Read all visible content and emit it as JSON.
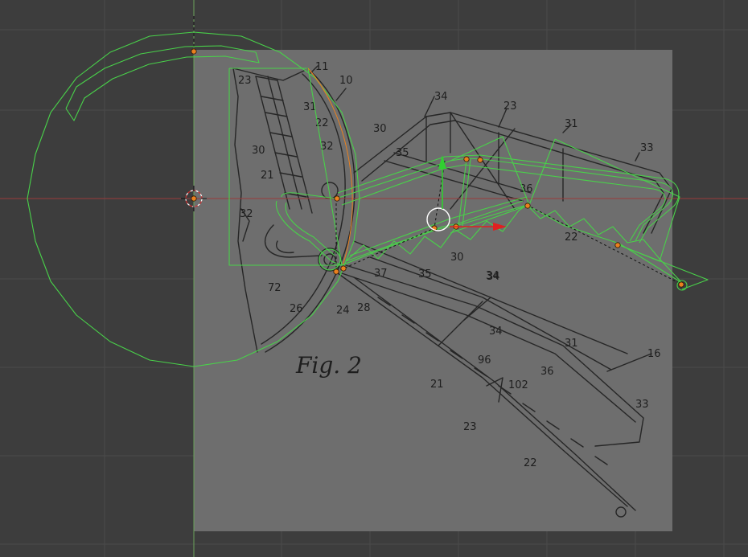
{
  "app": "3D Viewport",
  "reference_image": {
    "figure_label": "Fig. 2",
    "part_labels": [
      "23",
      "11",
      "10",
      "31",
      "22",
      "30",
      "32",
      "21",
      "32",
      "72",
      "26",
      "24",
      "28",
      "37",
      "35",
      "30",
      "34",
      "34",
      "23",
      "30",
      "35",
      "31",
      "33",
      "36",
      "22",
      "34",
      "34",
      "31",
      "16",
      "96",
      "102",
      "36",
      "21",
      "23",
      "33",
      "22"
    ]
  },
  "colors": {
    "background": "#3d3d3d",
    "grid_line": "#4a4a4a",
    "reference_plane": "#6e6e6e",
    "sketch_lines": "#262626",
    "wireframe": "#49d14a",
    "x_axis": "#9a3a3a",
    "y_axis": "#6aa35a",
    "vertex": "#e9801f",
    "gizmo_x": "#e02020",
    "gizmo_y": "#30d030",
    "cursor": "#ffffff"
  },
  "gizmo": {
    "x_axis": "x-arrow",
    "y_axis": "y-arrow"
  },
  "cursor_3d": "3d-cursor-icon"
}
